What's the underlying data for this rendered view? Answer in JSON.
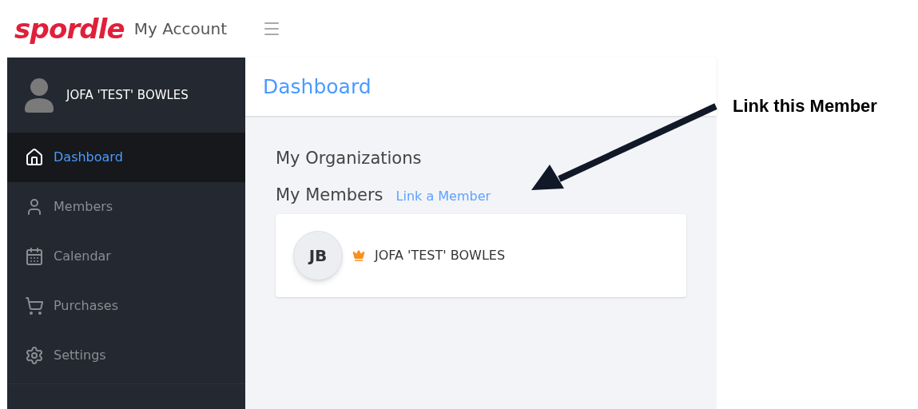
{
  "header": {
    "logo": "spordle",
    "title": "My Account"
  },
  "sidebar": {
    "user": "JOFA 'TEST' BOWLES",
    "items": [
      {
        "label": "Dashboard",
        "kind": "home",
        "selected": true
      },
      {
        "label": "Members",
        "kind": "user",
        "selected": false
      },
      {
        "label": "Calendar",
        "kind": "calendar",
        "selected": false
      },
      {
        "label": "Purchases",
        "kind": "cart",
        "selected": false
      },
      {
        "label": "Settings",
        "kind": "gear",
        "selected": false
      }
    ]
  },
  "main": {
    "title": "Dashboard",
    "organizations_heading": "My Organizations",
    "members_heading": "My Members",
    "link_label": "Link a Member",
    "members": [
      {
        "initials": "JB",
        "name": "JOFA 'TEST' BOWLES",
        "owner": true
      }
    ]
  },
  "annotation": {
    "text": "Link this Member"
  }
}
